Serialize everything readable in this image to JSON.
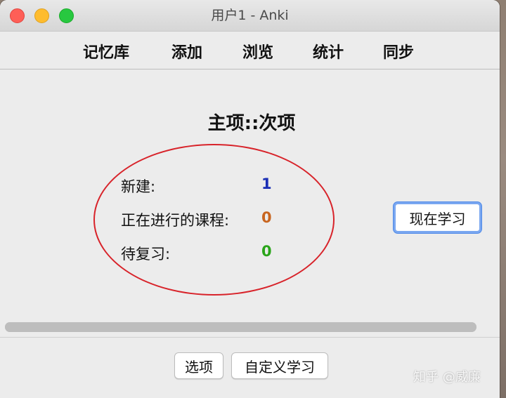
{
  "window": {
    "title": "用户1 - Anki"
  },
  "toolbar": {
    "decks": "记忆库",
    "add": "添加",
    "browse": "浏览",
    "stats": "统计",
    "sync": "同步"
  },
  "deck": {
    "title": "主项::次项",
    "stats": [
      {
        "label": "新建:",
        "value": "1",
        "color": "#1b2fb5"
      },
      {
        "label": "正在进行的课程:",
        "value": "0",
        "color": "#c8651f"
      },
      {
        "label": "待复习:",
        "value": "0",
        "color": "#2aa51a"
      }
    ],
    "study_now": "现在学习"
  },
  "progress": {
    "fraction": 1.0
  },
  "bottom": {
    "options": "选项",
    "custom_study": "自定义学习"
  },
  "watermark": "知乎 @威廉",
  "annotation": {
    "color": "#d8232a",
    "shape": "ellipse"
  }
}
